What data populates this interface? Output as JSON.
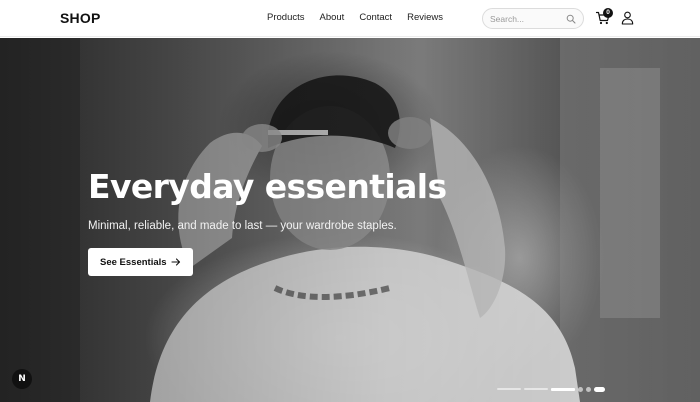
{
  "header": {
    "logo": "SHOP",
    "nav": [
      "Products",
      "About",
      "Contact",
      "Reviews"
    ],
    "search_placeholder": "Search...",
    "cart_count": "0"
  },
  "hero": {
    "title": "Everyday essentials",
    "subtitle": "Minimal, reliable, and made to last — your wardrobe staples.",
    "cta_label": "See Essentials",
    "slide_count": 6,
    "active_slide": 3
  },
  "badge": {
    "label": "N"
  },
  "icons": {
    "search": "search-icon",
    "cart": "cart-icon",
    "user": "user-icon",
    "cta_arrow": "arrow-right-icon"
  },
  "colors": {
    "text_primary": "#111111",
    "header_bg": "#ffffff",
    "cta_bg": "#ffffff"
  }
}
